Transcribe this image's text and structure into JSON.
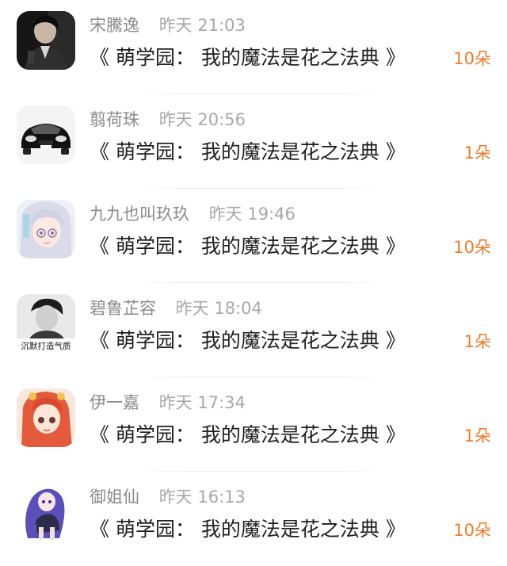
{
  "items": [
    {
      "name": "宋騰逸",
      "time": "昨天 21:03",
      "title": "《 萌学园： 我的魔法是花之法典 》",
      "gift": "10朵",
      "avatar": "man-portrait-avatar"
    },
    {
      "name": "翦荷珠",
      "time": "昨天 20:56",
      "title": "《 萌学园： 我的魔法是花之法典 》",
      "gift": "1朵",
      "avatar": "sports-car-avatar"
    },
    {
      "name": "九九也叫玖玖",
      "time": "昨天 19:46",
      "title": "《 萌学园： 我的魔法是花之法典 》",
      "gift": "10朵",
      "avatar": "anime-girl-glasses-avatar"
    },
    {
      "name": "碧鲁芷容",
      "time": "昨天 18:04",
      "title": "《 萌学园： 我的魔法是花之法典 》",
      "gift": "1朵",
      "avatar": "bw-portrait-avatar",
      "avatar_text": "沉默打造气质"
    },
    {
      "name": "伊一嘉",
      "time": "昨天 17:34",
      "title": "《 萌学园： 我的魔法是花之法典 》",
      "gift": "1朵",
      "avatar": "anime-redhead-avatar"
    },
    {
      "name": "御姐仙",
      "time": "昨天 16:13",
      "title": "《 萌学园： 我的魔法是花之法典 》",
      "gift": "10朵",
      "avatar": "anime-purple-hair-avatar"
    }
  ],
  "colors": {
    "gift": "#ee7a2a",
    "meta": "#8b8b8b",
    "title": "#1f1f1f"
  }
}
